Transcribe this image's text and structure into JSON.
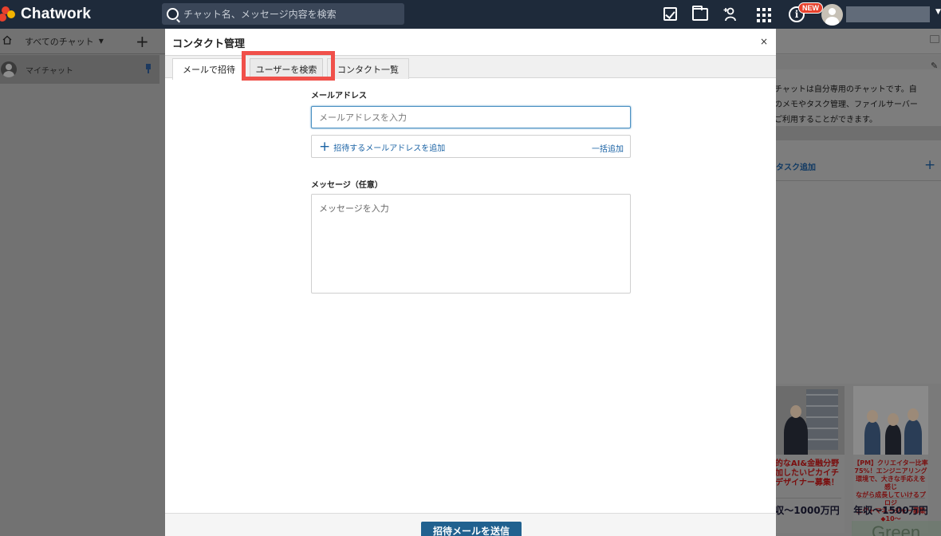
{
  "app": {
    "name": "Chatwork",
    "search_placeholder": "チャット名、メッセージ内容を検索",
    "new_badge": "NEW"
  },
  "sidebar": {
    "filter_label": "すべてのチャット",
    "filter_caret": "▼",
    "add": "+",
    "items": [
      {
        "label": "マイチャット"
      }
    ]
  },
  "right_panel": {
    "description_lines": [
      "チャットは自分専用のチャットです。自",
      "のメモやタスク管理、ファイルサーバー",
      "ご利用することができます。"
    ],
    "task_add_label": "タスク追加",
    "task_add_icon": "+",
    "ads": [
      {
        "caption_lines": [
          "的なAI&金融分野",
          "加したいピカイチ",
          "デザイナー募集！"
        ],
        "salary": "収～1000万円"
      },
      {
        "caption_lines": [
          "【PM】クリエイター比率",
          "75%！エンジニアリング",
          "環境で、大きな手応えを感じ",
          "ながら成長していけるプロジ",
          "ェクトマネージャー募集◆10～"
        ],
        "salary": "年収～1500万円"
      }
    ],
    "ad_brand": "Green"
  },
  "modal": {
    "title": "コンタクト管理",
    "close": "×",
    "tabs": [
      {
        "label": "メールで招待",
        "active": true
      },
      {
        "label": "ユーザーを検索",
        "active": false
      },
      {
        "label": "コンタクト一覧",
        "active": false
      }
    ],
    "email": {
      "label": "メールアドレス",
      "placeholder": "メールアドレスを入力",
      "value": ""
    },
    "add_email": {
      "label": "招待するメールアドレスを追加",
      "icon": "+",
      "bulk": "一括追加"
    },
    "message": {
      "label": "メッセージ（任意）",
      "placeholder": "メッセージを入力",
      "value": ""
    },
    "submit": "招待メールを送信"
  },
  "colors": {
    "topbar": "#1e2a3a",
    "accent": "#21618f",
    "link": "#1b63a5",
    "highlight": "#f0504a",
    "badge": "#e8412c"
  }
}
